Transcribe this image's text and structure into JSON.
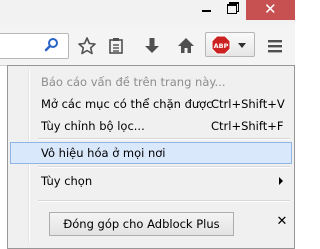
{
  "window": {
    "controls": [
      "minimize",
      "maximize",
      "close"
    ]
  },
  "toolbar": {
    "icons": [
      "search-icon",
      "star-icon",
      "reading-list-icon",
      "download-icon",
      "home-icon",
      "adblock-icon",
      "dropdown-icon",
      "hamburger-menu-icon"
    ],
    "abp_badge": "ABP",
    "abp_color": "#cc2121"
  },
  "menu": {
    "items": [
      {
        "label": "Báo cáo vấn đề trên trang này...",
        "shortcut": "",
        "disabled": true
      },
      {
        "label": "Mở các mục có thể chặn được",
        "shortcut": "Ctrl+Shift+V",
        "disabled": false
      },
      {
        "label": "Tùy chỉnh bộ lọc...",
        "shortcut": "Ctrl+Shift+F",
        "disabled": false
      },
      {
        "label": "Vô hiệu hóa ở mọi nơi",
        "shortcut": "",
        "highlighted": true
      },
      {
        "label": "Tùy chọn",
        "shortcut": "",
        "has_submenu": true
      }
    ],
    "contribute_label": "Đóng góp cho Adblock Plus",
    "close_symbol": "✕"
  },
  "colors": {
    "highlight_bg": "#d9e8fb",
    "highlight_border": "#8fb4e6",
    "close_button": "#c75050"
  }
}
